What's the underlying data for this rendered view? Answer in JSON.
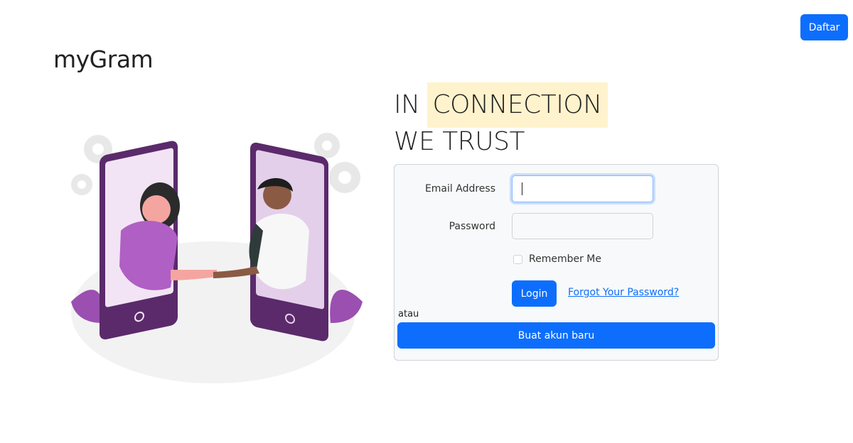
{
  "header": {
    "register_label": "Daftar"
  },
  "brand": {
    "name": "myGram"
  },
  "hero": {
    "line1_prefix": "IN",
    "line1_highlight": "CONNECTION",
    "line2": "WE TRUST"
  },
  "login_form": {
    "email_label": "Email Address",
    "email_value": "",
    "password_label": "Password",
    "password_value": "",
    "remember_label": "Remember Me",
    "remember_checked": false,
    "login_label": "Login",
    "forgot_label": "Forgot Your Password?",
    "separator": "atau",
    "create_account_label": "Buat akun baru"
  },
  "colors": {
    "primary": "#0d6efd",
    "highlight": "#fff3cd",
    "card_bg": "#f8f9fa",
    "accent_purple": "#8b4a9e"
  }
}
